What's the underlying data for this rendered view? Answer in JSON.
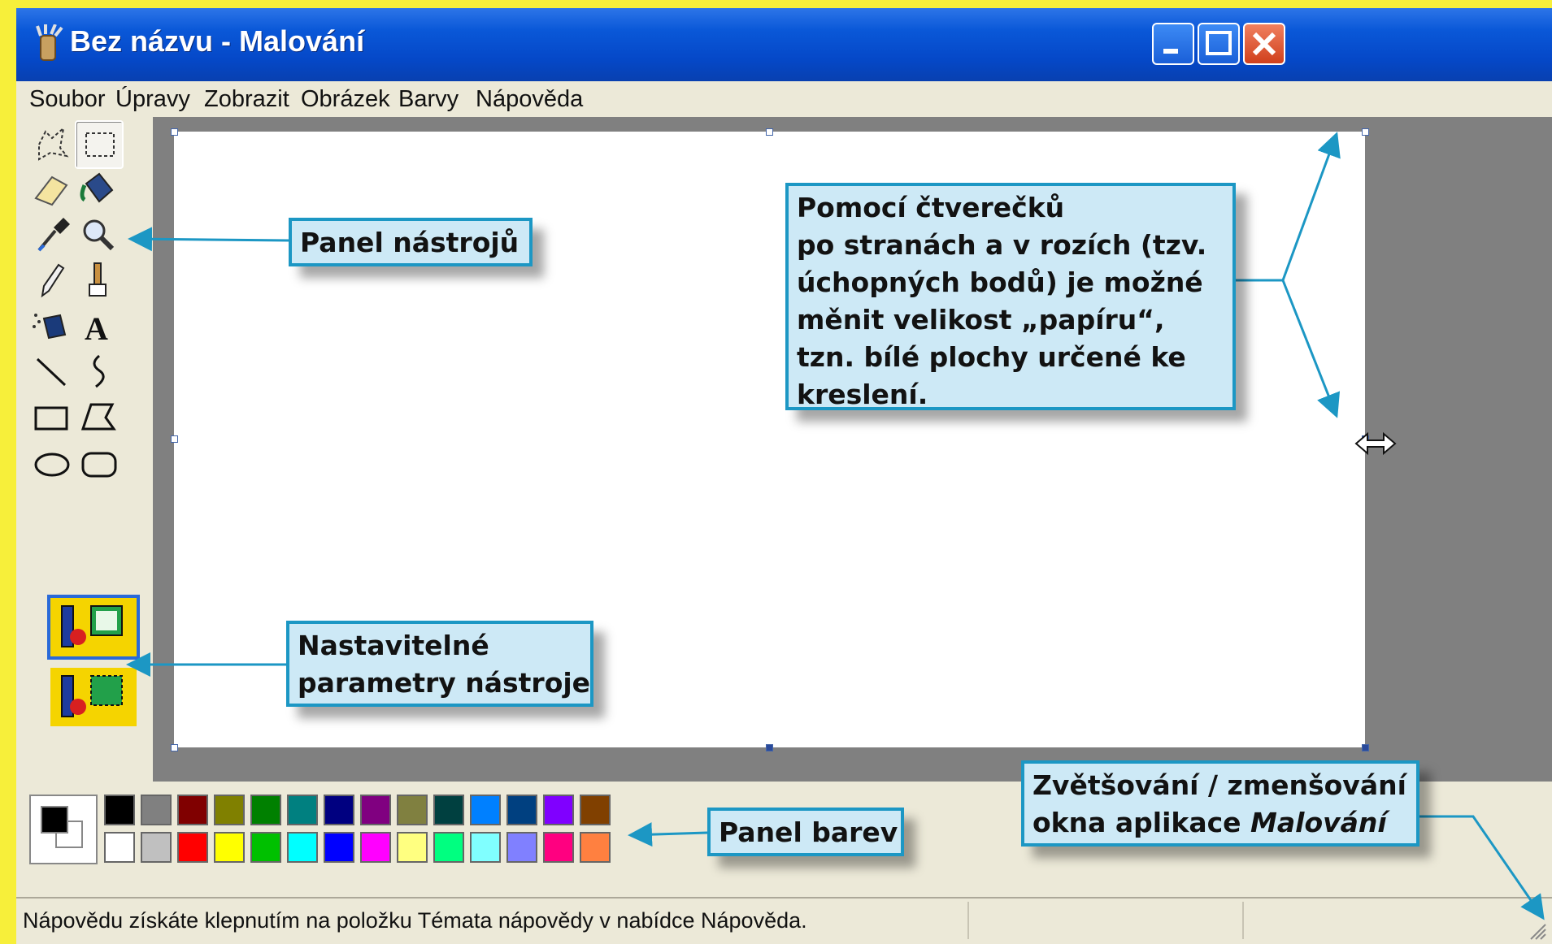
{
  "window": {
    "title": "Bez názvu - Malování",
    "controls": [
      "minimize",
      "maximize",
      "close"
    ]
  },
  "menu": {
    "items": [
      "Soubor",
      "Úpravy",
      "Zobrazit",
      "Obrázek",
      "Barvy",
      "Nápověda"
    ]
  },
  "toolbox": {
    "tools": [
      {
        "name": "free-select-icon"
      },
      {
        "name": "rect-select-icon",
        "selected": true
      },
      {
        "name": "eraser-icon"
      },
      {
        "name": "fill-bucket-icon"
      },
      {
        "name": "color-picker-icon"
      },
      {
        "name": "magnifier-icon"
      },
      {
        "name": "pencil-icon"
      },
      {
        "name": "brush-icon"
      },
      {
        "name": "airbrush-icon"
      },
      {
        "name": "text-icon",
        "glyph": "A"
      },
      {
        "name": "line-icon"
      },
      {
        "name": "curve-icon"
      },
      {
        "name": "rectangle-icon"
      },
      {
        "name": "polygon-icon"
      },
      {
        "name": "ellipse-icon"
      },
      {
        "name": "rounded-rect-icon"
      }
    ]
  },
  "palette": {
    "foreground": "#000000",
    "background": "#ffffff",
    "colors": [
      "#000000",
      "#808080",
      "#800000",
      "#808000",
      "#008000",
      "#008080",
      "#000080",
      "#800080",
      "#808040",
      "#004040",
      "#0080ff",
      "#004080",
      "#8000ff",
      "#804000",
      "#ffffff",
      "#c0c0c0",
      "#ff0000",
      "#ffff00",
      "#00c000",
      "#00ffff",
      "#0000ff",
      "#ff00ff",
      "#ffff80",
      "#00ff80",
      "#80ffff",
      "#8080ff",
      "#ff0080",
      "#ff8040"
    ]
  },
  "status": {
    "text": "Nápovědu získáte klepnutím na položku Témata nápovědy v nabídce Nápověda."
  },
  "callouts": {
    "tools_panel": {
      "lines": [
        "Panel nástrojů"
      ]
    },
    "tool_params": {
      "lines": [
        "Nastavitelné",
        "parametry nástroje"
      ]
    },
    "resize": {
      "lines": [
        "Pomocí čtverečků",
        "po stranách a v rozích (tzv.",
        "úchopných bodů) je možné",
        "měnit velikost „papíru“,",
        "tzn. bílé plochy určené ke",
        "kreslení."
      ]
    },
    "color_panel": {
      "lines": [
        "Panel barev"
      ]
    },
    "zoom": {
      "line1": "Zvětšování / zmenšování",
      "line2_prefix": "okna aplikace ",
      "line2_italic": "Malování"
    }
  },
  "colors": {
    "page_background": "#f7ef3a",
    "callout_fill": "#cde9f6",
    "callout_border": "#1c97c4",
    "titlebar": "#0a58d8",
    "workspace": "#808080"
  }
}
